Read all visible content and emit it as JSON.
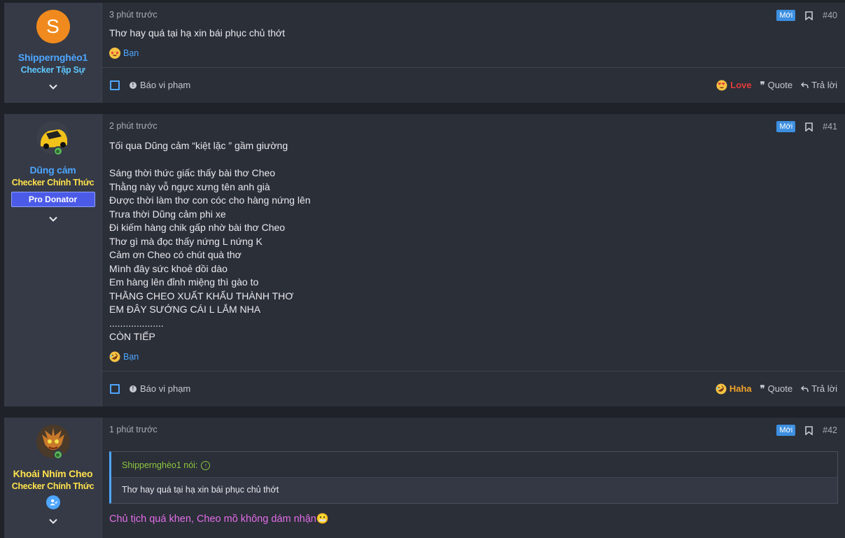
{
  "colors": {
    "link_blue": "#4ea6ff",
    "love_red": "#e03b3b",
    "haha_orange": "#f0a22a",
    "yellow_title": "#ffe14d",
    "cyan_title": "#5fc8ff",
    "pink_text": "#e26ee8",
    "green_quote": "#8cc63f"
  },
  "posts": [
    {
      "avatar_letter": "S",
      "username": "Shippernghèo1",
      "user_title": "Checker Tập Sự",
      "time": "3 phút trước",
      "new_badge": "Mới",
      "post_number": "#40",
      "body": "Thơ hay quá tại hạ xin bái phục chủ thớt",
      "reaction_by": "Bạn",
      "reaction_icon": "star-struck-emoji-icon",
      "report_label": "Báo vi phạm",
      "reaction_label": "Love",
      "quote_label": "Quote",
      "reply_label": "Trả lời"
    },
    {
      "username": "Dũng cảm",
      "user_title": "Checker Chính Thức",
      "banner": "Pro Donator",
      "time": "2 phút trước",
      "new_badge": "Mới",
      "post_number": "#41",
      "body_lines": [
        "Tối qua Dũng cảm “kiệt lặc ” gầm giường",
        "",
        "Sáng thời thức giấc thấy bài thơ Cheo",
        "Thằng này vỗ ngực xưng tên anh già",
        "Được thời làm thơ con cóc cho hàng nứng lên",
        "Trưa thời Dũng cảm phi xe",
        "Đi kiếm hàng chik gấp nhờ bài thơ Cheo",
        "Thơ gì mà đọc thấy nứng L nứng K",
        "Cảm ơn Cheo có chút quà thơ",
        "Mình đây sức khoẻ dồi dào",
        "Em hàng lên đỉnh miệng thì gào to",
        "THẰNG CHEO XUẤT KHẨU THÀNH THƠ",
        "EM ĐÂY SƯỚNG CÁI L LẮM NHA",
        "....................",
        "CÒN TIẾP"
      ],
      "reaction_by": "Bạn",
      "reaction_icon": "rofl-emoji-icon",
      "report_label": "Báo vi phạm",
      "reaction_label": "Haha",
      "quote_label": "Quote",
      "reply_label": "Trả lời"
    },
    {
      "username": "Khoái Nhím Cheo",
      "user_title": "Checker Chính Thức",
      "time": "1 phút trước",
      "new_badge": "Mới",
      "post_number": "#42",
      "quote_author": "Shippernghèo1 nói:",
      "quote_text": "Thơ hay quá tại hạ xin bái phục chủ thớt",
      "body": "Chủ tịch quá khen, Cheo mồ không dám nhận😬"
    }
  ]
}
